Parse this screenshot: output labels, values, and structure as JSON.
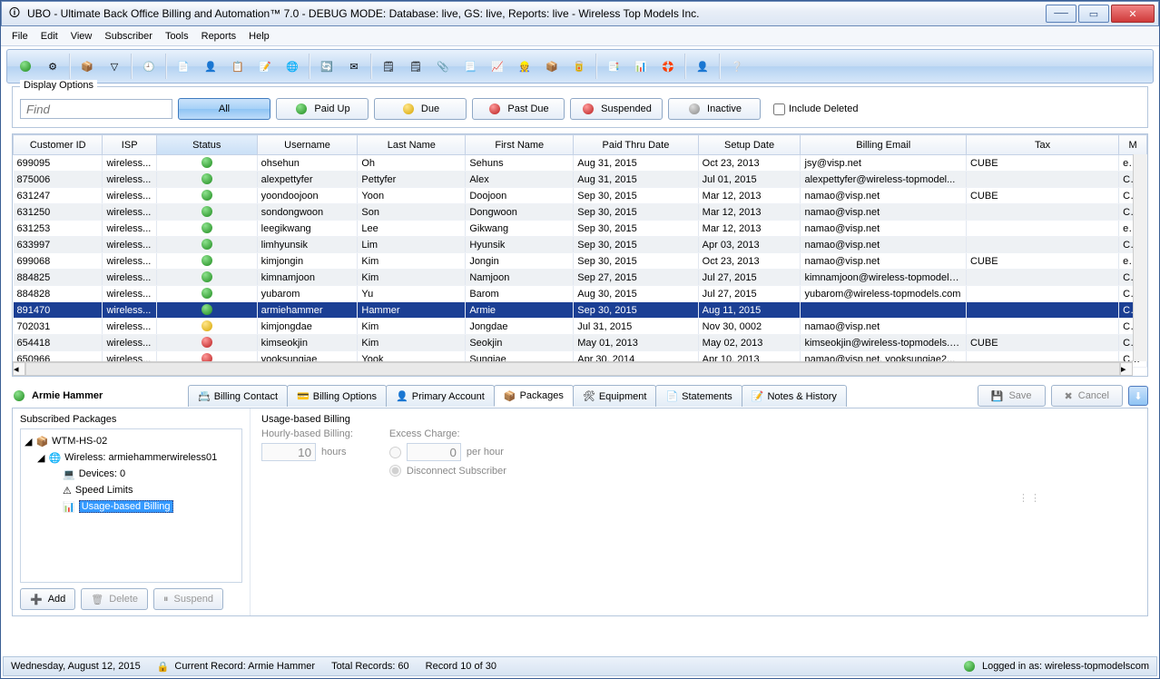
{
  "window": {
    "title": "UBO - Ultimate Back Office Billing and Automation™ 7.0 - DEBUG MODE: Database: live, GS: live, Reports: live - Wireless Top Models Inc."
  },
  "menu": [
    "File",
    "Edit",
    "View",
    "Subscriber",
    "Tools",
    "Reports",
    "Help"
  ],
  "display_options": {
    "legend": "Display Options",
    "find_placeholder": "Find",
    "filters": {
      "all": "All",
      "paid_up": "Paid Up",
      "due": "Due",
      "past_due": "Past Due",
      "suspended": "Suspended",
      "inactive": "Inactive"
    },
    "include_deleted": "Include Deleted"
  },
  "grid": {
    "columns": [
      "Customer ID",
      "ISP",
      "Status",
      "Username",
      "Last Name",
      "First Name",
      "Paid Thru Date",
      "Setup Date",
      "Billing Email",
      "Tax",
      "M"
    ],
    "rows": [
      {
        "id": "699095",
        "isp": "wireless...",
        "status": "green",
        "user": "ohsehun",
        "last": "Oh",
        "first": "Sehuns",
        "paid": "Aug 31, 2015",
        "setup": "Oct 23, 2013",
        "email": "jsy@visp.net",
        "tax": "CUBE",
        "m": "eChe"
      },
      {
        "id": "875006",
        "isp": "wireless...",
        "status": "green",
        "user": "alexpettyfer",
        "last": "Pettyfer",
        "first": "Alex",
        "paid": "Aug 31, 2015",
        "setup": "Jul 01, 2015",
        "email": "alexpettyfer@wireless-topmodel...",
        "tax": "",
        "m": "Cred"
      },
      {
        "id": "631247",
        "isp": "wireless...",
        "status": "green",
        "user": "yoondoojoon",
        "last": "Yoon",
        "first": "Doojoon",
        "paid": "Sep 30, 2015",
        "setup": "Mar 12, 2013",
        "email": "namao@visp.net",
        "tax": "CUBE",
        "m": "Cred"
      },
      {
        "id": "631250",
        "isp": "wireless...",
        "status": "green",
        "user": "sondongwoon",
        "last": "Son",
        "first": "Dongwoon",
        "paid": "Sep 30, 2015",
        "setup": "Mar 12, 2013",
        "email": "namao@visp.net",
        "tax": "",
        "m": "Cred"
      },
      {
        "id": "631253",
        "isp": "wireless...",
        "status": "green",
        "user": "leegikwang",
        "last": "Lee",
        "first": "Gikwang",
        "paid": "Sep 30, 2015",
        "setup": "Mar 12, 2013",
        "email": "namao@visp.net",
        "tax": "",
        "m": "eChe"
      },
      {
        "id": "633997",
        "isp": "wireless...",
        "status": "green",
        "user": "limhyunsik",
        "last": "Lim",
        "first": "Hyunsik",
        "paid": "Sep 30, 2015",
        "setup": "Apr 03, 2013",
        "email": "namao@visp.net",
        "tax": "",
        "m": "Cred"
      },
      {
        "id": "699068",
        "isp": "wireless...",
        "status": "green",
        "user": "kimjongin",
        "last": "Kim",
        "first": "Jongin",
        "paid": "Sep 30, 2015",
        "setup": "Oct 23, 2013",
        "email": "namao@visp.net",
        "tax": "CUBE",
        "m": "eChe"
      },
      {
        "id": "884825",
        "isp": "wireless...",
        "status": "green",
        "user": "kimnamjoon",
        "last": "Kim",
        "first": "Namjoon",
        "paid": "Sep 27, 2015",
        "setup": "Jul 27, 2015",
        "email": "kimnamjoon@wireless-topmodels...",
        "tax": "",
        "m": "Cred"
      },
      {
        "id": "884828",
        "isp": "wireless...",
        "status": "green",
        "user": "yubarom",
        "last": "Yu",
        "first": "Barom",
        "paid": "Aug 30, 2015",
        "setup": "Jul 27, 2015",
        "email": "yubarom@wireless-topmodels.com",
        "tax": "",
        "m": "Cred"
      },
      {
        "id": "891470",
        "isp": "wireless...",
        "status": "green",
        "user": "armiehammer",
        "last": "Hammer",
        "first": "Armie",
        "paid": "Sep 30, 2015",
        "setup": "Aug 11, 2015",
        "email": "",
        "tax": "",
        "m": "Chec",
        "selected": true
      },
      {
        "id": "702031",
        "isp": "wireless...",
        "status": "yellow",
        "user": "kimjongdae",
        "last": "Kim",
        "first": "Jongdae",
        "paid": "Jul 31, 2015",
        "setup": "Nov 30, 0002",
        "email": "namao@visp.net",
        "tax": "",
        "m": "Cash"
      },
      {
        "id": "654418",
        "isp": "wireless...",
        "status": "red",
        "user": "kimseokjin",
        "last": "Kim",
        "first": "Seokjin",
        "paid": "May 01, 2013",
        "setup": "May 02, 2013",
        "email": "kimseokjin@wireless-topmodels.com",
        "tax": "CUBE",
        "m": "Cash"
      },
      {
        "id": "650966",
        "isp": "wireless...",
        "status": "red",
        "user": "yooksungjae",
        "last": "Yook",
        "first": "Sungjae",
        "paid": "Apr 30, 2014",
        "setup": "Apr 10, 2013",
        "email": "namao@visp.net, yooksungjae2...",
        "tax": "",
        "m": "Cash"
      }
    ]
  },
  "subscriber": {
    "name": "Armie Hammer",
    "tabs": {
      "billing_contact": "Billing Contact",
      "billing_options": "Billing Options",
      "primary_account": "Primary Account",
      "packages": "Packages",
      "equipment": "Equipment",
      "statements": "Statements",
      "notes": "Notes & History"
    },
    "save": "Save",
    "cancel": "Cancel"
  },
  "packages": {
    "header": "Subscribed Packages",
    "tree": {
      "root": "WTM-HS-02",
      "child": "Wireless: armiehammerwireless01",
      "devices": "Devices: 0",
      "speed": "Speed Limits",
      "usage": "Usage-based Billing"
    },
    "add": "Add",
    "delete": "Delete",
    "suspend": "Suspend"
  },
  "detail": {
    "title": "Usage-based Billing",
    "hourly_label": "Hourly-based Billing:",
    "hours_value": "10",
    "hours_unit": "hours",
    "excess_label": "Excess Charge:",
    "excess_value": "0",
    "excess_unit": "per hour",
    "disconnect": "Disconnect Subscriber"
  },
  "status": {
    "date": "Wednesday, August 12, 2015",
    "current": "Current Record: Armie Hammer",
    "total": "Total Records: 60",
    "record": "Record 10 of 30",
    "logged": "Logged in as: wireless-topmodelscom"
  }
}
